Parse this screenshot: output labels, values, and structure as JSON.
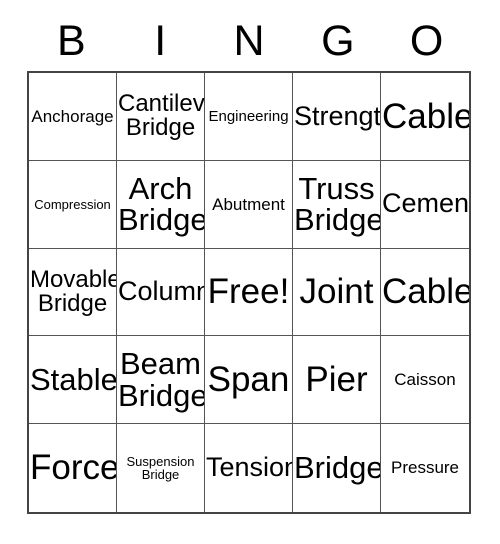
{
  "card": {
    "title": "BINGO",
    "columns": [
      "B",
      "I",
      "N",
      "G",
      "O"
    ],
    "free_space_label": "Free!",
    "colors": {
      "text": "#000000",
      "background": "#ffffff",
      "outer_border": "#444444",
      "inner_border": "#555555"
    },
    "grid": {
      "rows": 5,
      "cols": 5,
      "cells": [
        [
          {
            "text": "Anchorage",
            "size": "sm"
          },
          {
            "text": "Cantilever\nBridge",
            "size": "md"
          },
          {
            "text": "Engineering",
            "size": "xs"
          },
          {
            "text": "Strength",
            "size": "lg"
          },
          {
            "text": "Cable",
            "size": "xxl"
          }
        ],
        [
          {
            "text": "Compression",
            "size": "xxs"
          },
          {
            "text": "Arch\nBridge",
            "size": "xl"
          },
          {
            "text": "Abutment",
            "size": "sm"
          },
          {
            "text": "Truss\nBridge",
            "size": "xl"
          },
          {
            "text": "Cement",
            "size": "lg"
          }
        ],
        [
          {
            "text": "Movable\nBridge",
            "size": "md"
          },
          {
            "text": "Column",
            "size": "lg"
          },
          {
            "text": "Free!",
            "size": "xxl"
          },
          {
            "text": "Joint",
            "size": "xxl"
          },
          {
            "text": "Cable",
            "size": "xxl"
          }
        ],
        [
          {
            "text": "Stable",
            "size": "xl"
          },
          {
            "text": "Beam\nBridge",
            "size": "xl"
          },
          {
            "text": "Span",
            "size": "xxl"
          },
          {
            "text": "Pier",
            "size": "xxl"
          },
          {
            "text": "Caisson",
            "size": "sm"
          }
        ],
        [
          {
            "text": "Force",
            "size": "xxl"
          },
          {
            "text": "Suspension\nBridge",
            "size": "xxs"
          },
          {
            "text": "Tension",
            "size": "lg"
          },
          {
            "text": "Bridge",
            "size": "xl"
          },
          {
            "text": "Pressure",
            "size": "sm"
          }
        ]
      ]
    }
  }
}
